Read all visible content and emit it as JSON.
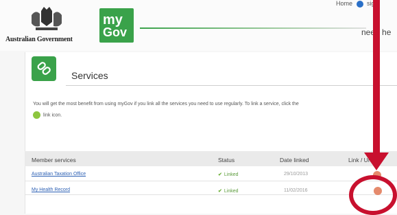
{
  "header": {
    "government": "Australian Government",
    "logo_my": "my",
    "logo_gov": "Gov",
    "link_home": "Home",
    "link_sign": "sign",
    "need_help": "need he"
  },
  "services": {
    "title": "Services",
    "intro": "You will get the most benefit from using myGov if you link all the services you need to use regularly. To link a service, click the",
    "intro_link_text": "link icon."
  },
  "table": {
    "headers": [
      "Member services",
      "Status",
      "Date linked",
      "Link / Unlink"
    ],
    "rows": [
      {
        "service": "Australian Taxation Office",
        "status": "Linked",
        "date": "29/10/2013"
      },
      {
        "service": "My Health Record",
        "status": "Linked",
        "date": "11/02/2016"
      }
    ]
  },
  "colors": {
    "brand_green": "#3aa24a",
    "annotation_red": "#c8102e",
    "link_blue": "#2b5fb3"
  }
}
